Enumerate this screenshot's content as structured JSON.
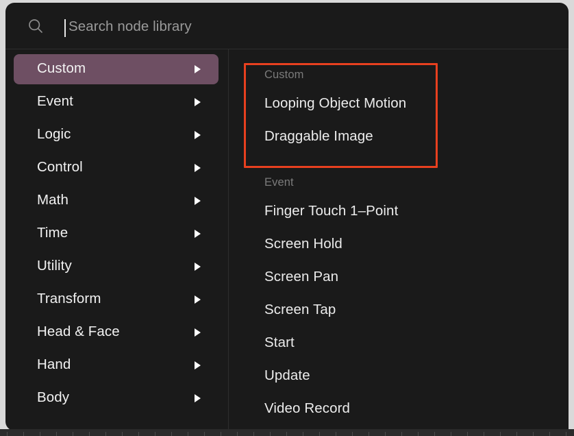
{
  "search": {
    "placeholder": "Search node library",
    "value": "",
    "icon": "search-icon"
  },
  "sidebar": {
    "items": [
      {
        "label": "Custom",
        "selected": true,
        "arrow": "caret-right-icon"
      },
      {
        "label": "Event",
        "selected": false,
        "arrow": "caret-right-icon"
      },
      {
        "label": "Logic",
        "selected": false,
        "arrow": "caret-right-icon"
      },
      {
        "label": "Control",
        "selected": false,
        "arrow": "caret-right-icon"
      },
      {
        "label": "Math",
        "selected": false,
        "arrow": "caret-right-icon"
      },
      {
        "label": "Time",
        "selected": false,
        "arrow": "caret-right-icon"
      },
      {
        "label": "Utility",
        "selected": false,
        "arrow": "caret-right-icon"
      },
      {
        "label": "Transform",
        "selected": false,
        "arrow": "caret-right-icon"
      },
      {
        "label": "Head & Face",
        "selected": false,
        "arrow": "caret-right-icon"
      },
      {
        "label": "Hand",
        "selected": false,
        "arrow": "caret-right-icon"
      },
      {
        "label": "Body",
        "selected": false,
        "arrow": "caret-right-icon"
      }
    ]
  },
  "nodelist": {
    "sections": [
      {
        "header": "Custom",
        "items": [
          "Looping Object Motion",
          "Draggable Image"
        ]
      },
      {
        "header": "Event",
        "items": [
          "Finger Touch 1–Point",
          "Screen Hold",
          "Screen Pan",
          "Screen Tap",
          "Start",
          "Update",
          "Video Record"
        ]
      }
    ]
  },
  "annotation": {
    "highlight_color": "#e8401f"
  },
  "colors": {
    "window_background": "#1a1a1a",
    "selected_category": "#6e4f63",
    "divider": "#2e2e2e",
    "primary_text": "#ececec",
    "muted_text": "#7b7b7b",
    "page_background": "#d9d9d9"
  }
}
